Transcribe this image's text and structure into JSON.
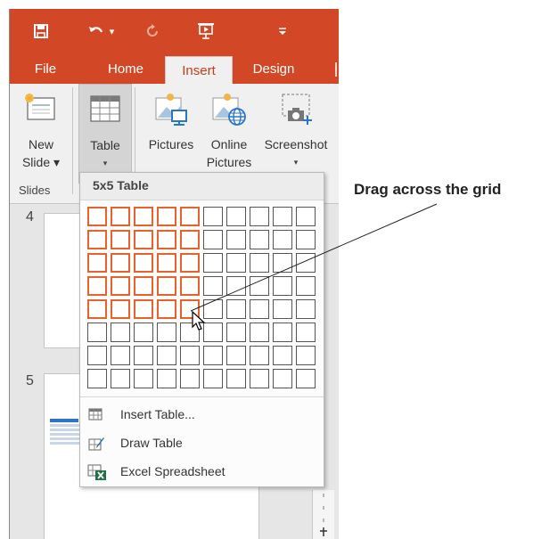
{
  "qat": {
    "save_icon": "save-icon",
    "undo_icon": "undo-icon",
    "undo_caret": "▾",
    "redo_icon": "redo-icon",
    "present_icon": "start-from-beginning-icon",
    "customize_icon": "customize-qat-icon"
  },
  "tabs": [
    {
      "label": "File"
    },
    {
      "label": "Home"
    },
    {
      "label": "Insert"
    },
    {
      "label": "Design"
    }
  ],
  "ribbon": {
    "new_slide": {
      "line1": "New",
      "line2": "Slide ▾"
    },
    "table": {
      "line1": "Table",
      "caret": "▾"
    },
    "pictures": {
      "label": "Pictures"
    },
    "online_pictures": {
      "line1": "Online",
      "line2": "Pictures"
    },
    "screenshot": {
      "label": "Screenshot",
      "caret": "▾"
    },
    "groups": {
      "slides": "Slides"
    }
  },
  "slides": [
    {
      "number": "4"
    },
    {
      "number": "5"
    }
  ],
  "table_dropdown": {
    "title": "5x5 Table",
    "grid_columns": 10,
    "grid_rows": 8,
    "selected_columns": 5,
    "selected_rows": 5,
    "menu": [
      {
        "label": "Insert Table...",
        "icon": "insert-table-icon"
      },
      {
        "label": "Draw Table",
        "icon": "draw-table-icon"
      },
      {
        "label": "Excel Spreadsheet",
        "icon": "excel-spreadsheet-icon"
      }
    ]
  },
  "callout": {
    "text": "Drag across the grid"
  },
  "colors": {
    "accent": "#d24726",
    "selection": "#e8622e",
    "active_tab_text": "#c43e1c"
  }
}
